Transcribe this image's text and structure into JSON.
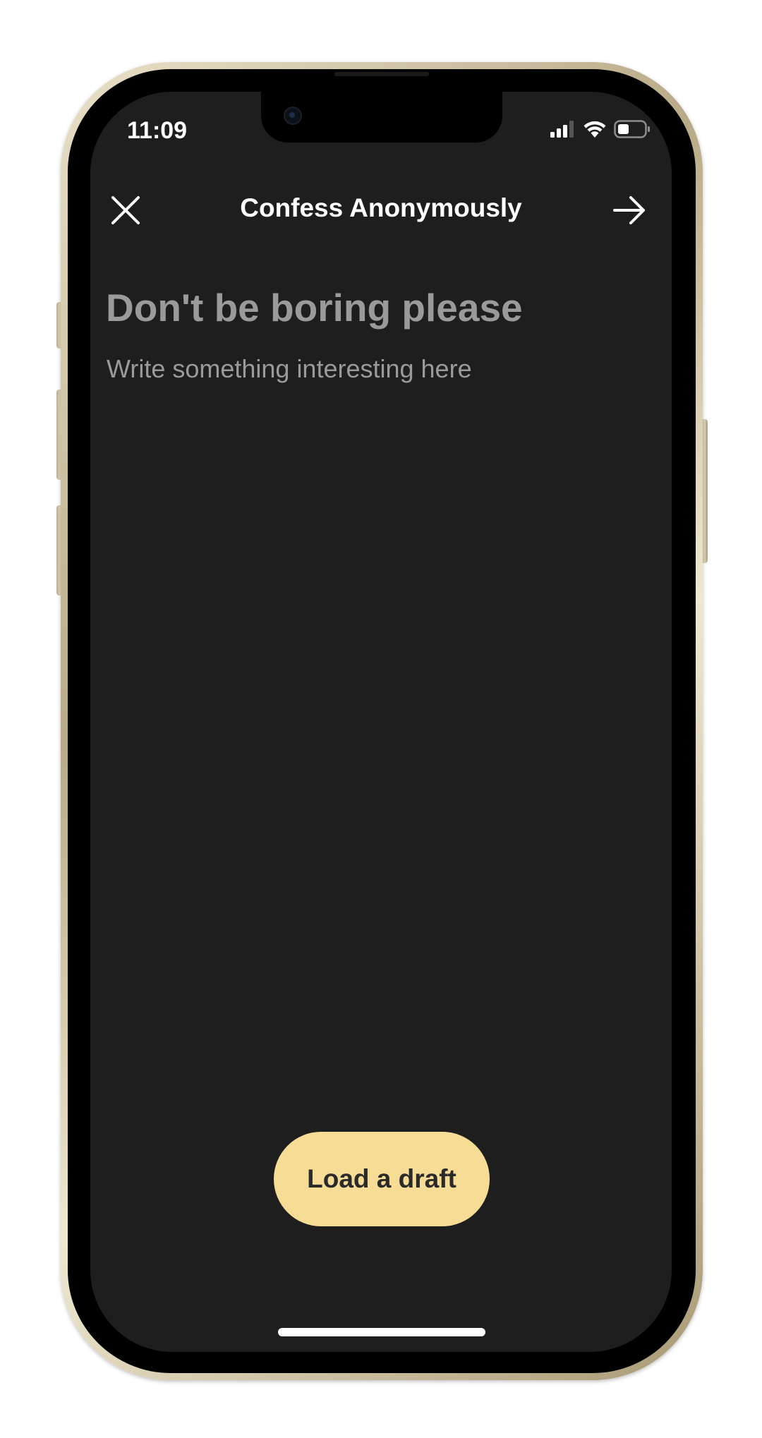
{
  "status_bar": {
    "time": "11:09"
  },
  "nav": {
    "title": "Confess Anonymously",
    "close_icon": "close-icon",
    "next_icon": "arrow-right-icon"
  },
  "compose": {
    "title_placeholder": "Don't be boring please",
    "body_placeholder": "Write something interesting here"
  },
  "actions": {
    "load_draft_label": "Load a draft"
  },
  "colors": {
    "screen_background": "#1e1e1e",
    "accent_button": "#f7dc95",
    "placeholder_text": "#9a9a9a",
    "frame_gold": "#c9bc98"
  }
}
